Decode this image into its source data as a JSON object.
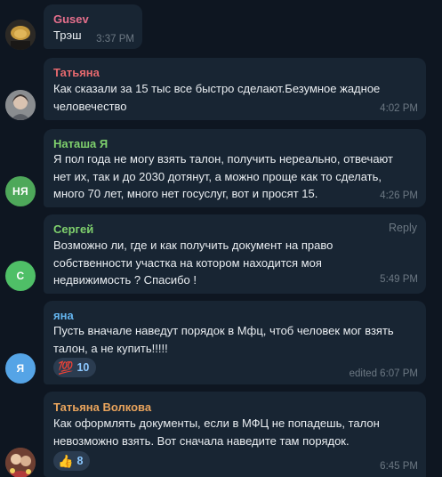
{
  "colors": {
    "background": "#0e1621",
    "bubble": "#182533",
    "text": "#e9edf1",
    "time": "#6c7883",
    "reaction_bg": "#2b3c50",
    "reaction_count": "#8cc8ff"
  },
  "messages": [
    {
      "sender": "Gusev",
      "sender_color": "#e56f8c",
      "lines": [
        "Трэш"
      ],
      "time": "3:37 PM",
      "avatar": {
        "type": "photo",
        "icon": "gusev-photo-avatar"
      }
    },
    {
      "sender": "Татьяна",
      "sender_color": "#e5696e",
      "lines": [
        "Как сказали за 15 тыс все быстро сделают.Безумное жадное",
        "человечество"
      ],
      "time": "4:02 PM",
      "avatar": {
        "type": "photo",
        "icon": "tatiana-photo-avatar"
      }
    },
    {
      "sender": "Наташа Я",
      "sender_color": "#7fd16d",
      "lines": [
        "Я пол года не могу взять талон, получить нереально, отвечают",
        "нет их, так и до 2030 дотянут, а можно проще как то сделать,",
        "много 70 лет, много нет госуслуг, вот и просят 15."
      ],
      "time": "4:26 PM",
      "avatar": {
        "type": "initials",
        "initials": "НЯ",
        "color": "#4ea85a"
      }
    },
    {
      "sender": "Сергей",
      "sender_color": "#7fd16d",
      "reply_label": "Reply",
      "lines": [
        "Возможно ли, где и как получить документ на право",
        "собственности участка на котором находится моя",
        "недвижимость ? Спасибо !"
      ],
      "time": "5:49 PM",
      "avatar": {
        "type": "initials",
        "initials": "С",
        "color": "#4fbf67"
      }
    },
    {
      "sender": "яна",
      "sender_color": "#64b5ef",
      "lines": [
        "Пусть вначале наведут порядок в Мфц, чтоб человек мог взять",
        "талон, а не купить!!!!!"
      ],
      "reaction": {
        "emoji": "💯",
        "count": "10"
      },
      "time": "edited 6:07 PM",
      "avatar": {
        "type": "initials",
        "initials": "Я",
        "color": "#55a4e6"
      }
    },
    {
      "sender": "Татьяна Волкова",
      "sender_color": "#e8a35c",
      "lines": [
        "Как оформлять документы, если в МФЦ не попадешь, талон",
        "невозможно взять. Вот сначала наведите там порядок."
      ],
      "reaction": {
        "emoji": "👍",
        "count": "8"
      },
      "time": "6:45 PM",
      "avatar": {
        "type": "photo",
        "icon": "volkova-photo-avatar"
      }
    }
  ]
}
